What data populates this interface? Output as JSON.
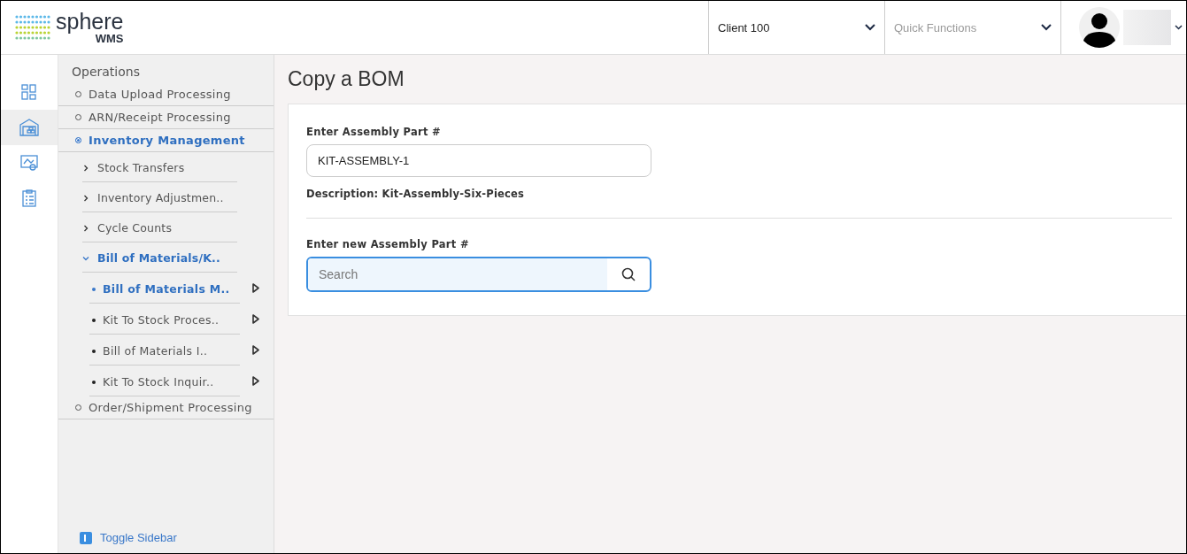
{
  "header": {
    "logo": {
      "name": "sphere",
      "subtitle": "WMS"
    },
    "client_select": {
      "value": "Client 100"
    },
    "quick_functions": {
      "placeholder": "Quick Functions"
    }
  },
  "icon_rail": [
    {
      "selected": false
    },
    {
      "selected": true
    },
    {
      "selected": false
    },
    {
      "selected": false
    }
  ],
  "sidebar": {
    "heading": "Operations",
    "items": [
      {
        "label": "Data Upload Processing",
        "selected": false
      },
      {
        "label": "ARN/Receipt Processing",
        "selected": false
      },
      {
        "label": "Inventory Management",
        "selected": true,
        "children": [
          {
            "label": "Stock Transfers",
            "selected": false,
            "expanded": false
          },
          {
            "label": "Inventory Adjustmen..",
            "selected": false,
            "expanded": false
          },
          {
            "label": "Cycle Counts",
            "selected": false,
            "expanded": false
          },
          {
            "label": "Bill of Materials/K..",
            "selected": true,
            "expanded": true,
            "children": [
              {
                "label": "Bill of Materials M..",
                "selected": true
              },
              {
                "label": "Kit To Stock Proces..",
                "selected": false
              },
              {
                "label": "Bill of Materials I..",
                "selected": false
              },
              {
                "label": "Kit To Stock Inquir..",
                "selected": false
              }
            ]
          }
        ]
      },
      {
        "label": "Order/Shipment Processing",
        "selected": false
      }
    ],
    "toggle": "Toggle Sidebar"
  },
  "main": {
    "title": "Copy a BOM",
    "assembly_part": {
      "label": "Enter Assembly Part #",
      "value": "KIT-ASSEMBLY-1"
    },
    "description": "Description: Kit-Assembly-Six-Pieces",
    "new_part": {
      "label": "Enter new Assembly Part #",
      "placeholder": "Search"
    }
  }
}
